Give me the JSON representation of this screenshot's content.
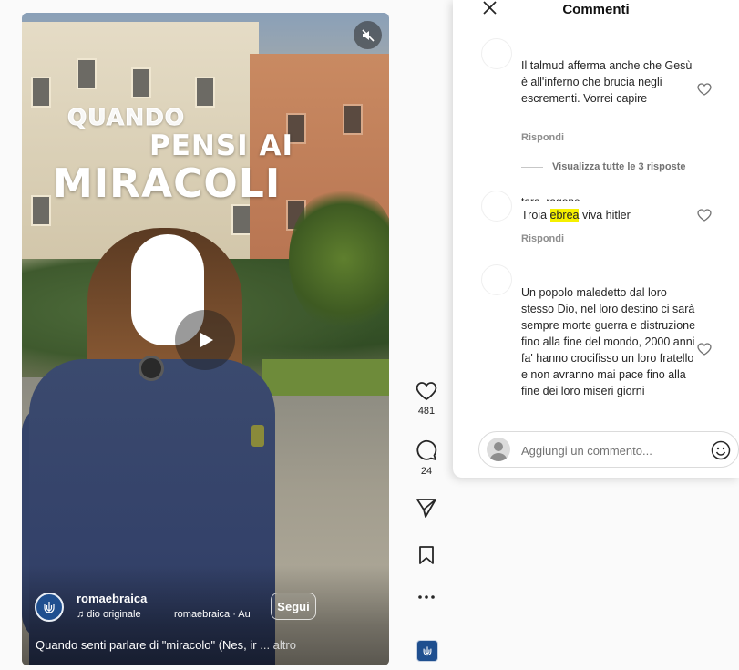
{
  "video": {
    "title_lines": [
      "QUANDO",
      "PENSI AI",
      "MIRACOLI"
    ],
    "username": "romaebraica",
    "audio_label": "dio originale",
    "audio_secondary": "romaebraica · Au",
    "follow_label": "Segui",
    "caption": "Quando senti parlare di \"miracolo\" (Nes, ir",
    "caption_more": "... altro"
  },
  "actions": {
    "like_count": "481",
    "comment_count": "24"
  },
  "comments_panel": {
    "title": "Commenti",
    "comments": [
      {
        "text": "Il talmud afferma anche che Gesù è all'inferno che brucia negli escrementi. Vorrei capire",
        "reply_label": "Rispondi",
        "view_replies": "Visualizza tutte le 3 risposte"
      },
      {
        "username_partial": "tara_ragone",
        "text_before": "Troia ",
        "text_highlight": "ebrea",
        "text_after": " viva hitler",
        "reply_label": "Rispondi"
      },
      {
        "text": "Un popolo maledetto dal loro stesso Dio, nel loro destino ci sarà sempre morte guerra e distruzione fino alla fine del mondo, 2000 anni fa' hanno crocifisso un loro fratello e non avranno mai pace fino alla fine dei loro miseri giorni"
      }
    ],
    "input_placeholder": "Aggiungi un commento..."
  },
  "colors": {
    "highlight": "#f5f000",
    "logo_blue": "#1f4f8f"
  },
  "icons": [
    "close-icon",
    "mute-icon",
    "play-icon",
    "heart-icon",
    "comment-icon",
    "share-icon",
    "bookmark-icon",
    "more-icon",
    "music-note-icon",
    "emoji-icon",
    "user-avatar-icon"
  ]
}
